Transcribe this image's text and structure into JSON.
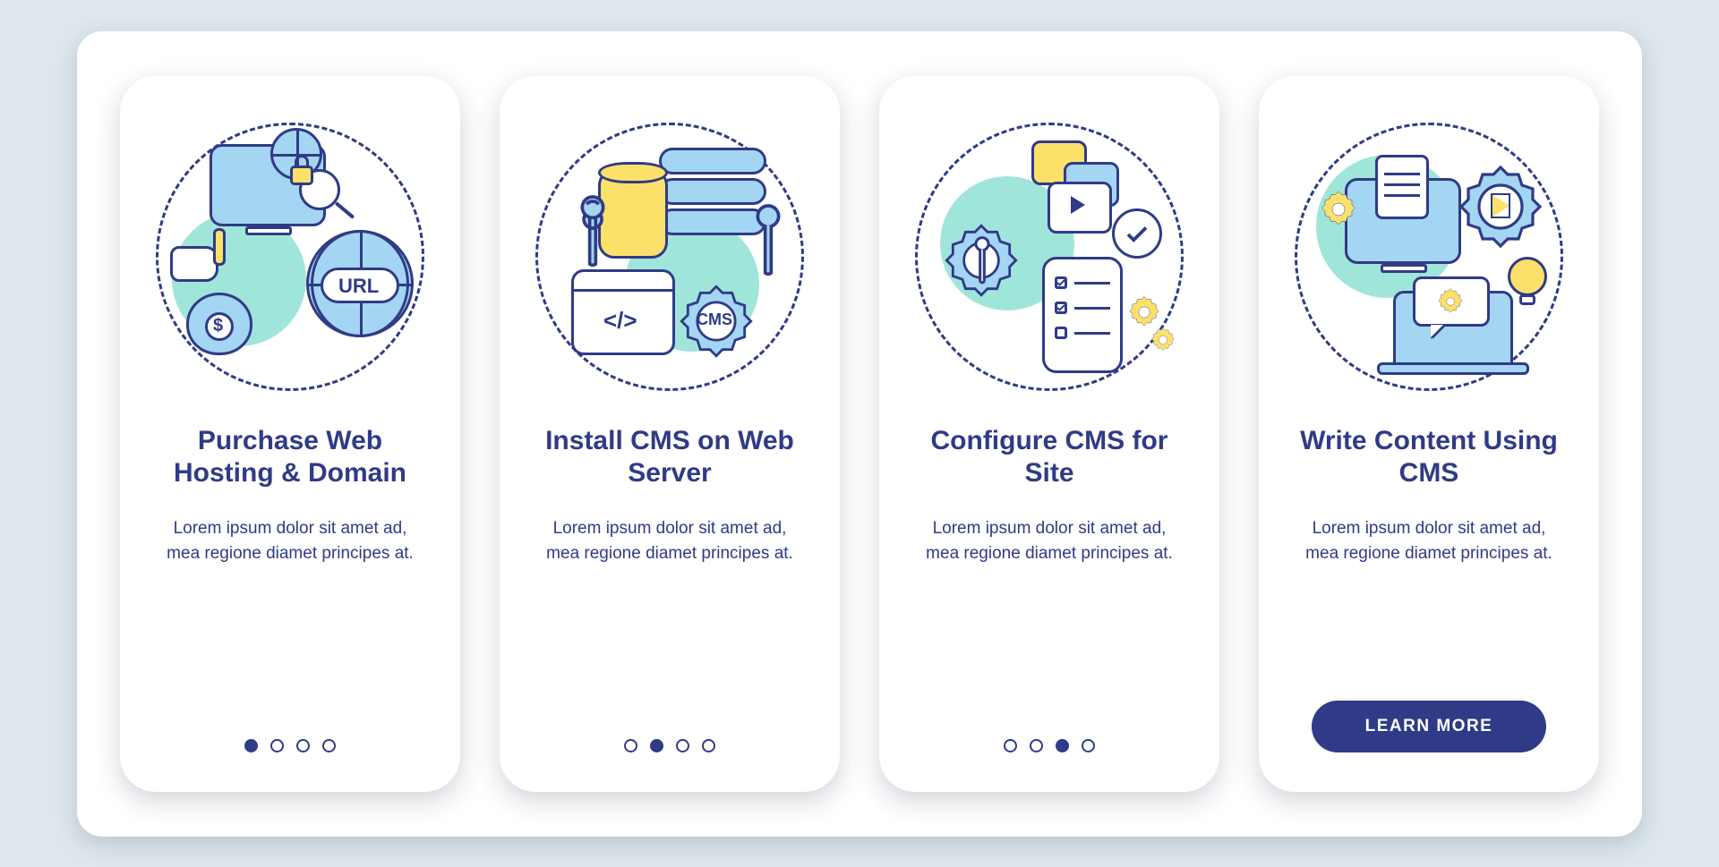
{
  "colors": {
    "primary": "#2f3b86",
    "accent_yellow": "#fbe16a",
    "accent_blue": "#a4d5f2",
    "accent_mint": "#A0E5D9"
  },
  "cta_label": "LEARN MORE",
  "slides": [
    {
      "title": "Purchase Web Hosting & Domain",
      "desc": "Lorem ipsum dolor sit amet ad, mea regione diamet principes at.",
      "active_dot": 0,
      "icon": "purchase-hosting-domain-icon",
      "url_tag": "URL",
      "money_symbol": "$"
    },
    {
      "title": "Install CMS on Web Server",
      "desc": "Lorem ipsum dolor sit amet ad, mea regione diamet principes at.",
      "active_dot": 1,
      "icon": "install-cms-server-icon",
      "cms_tag": "CMS",
      "code_tag": "</>"
    },
    {
      "title": "Configure CMS for Site",
      "desc": "Lorem ipsum dolor sit amet ad, mea regione diamet principes at.",
      "active_dot": 2,
      "icon": "configure-cms-site-icon"
    },
    {
      "title": "Write Content Using CMS",
      "desc": "Lorem ipsum dolor sit amet ad, mea regione diamet principes at.",
      "active_dot": 3,
      "icon": "write-content-cms-icon"
    }
  ]
}
